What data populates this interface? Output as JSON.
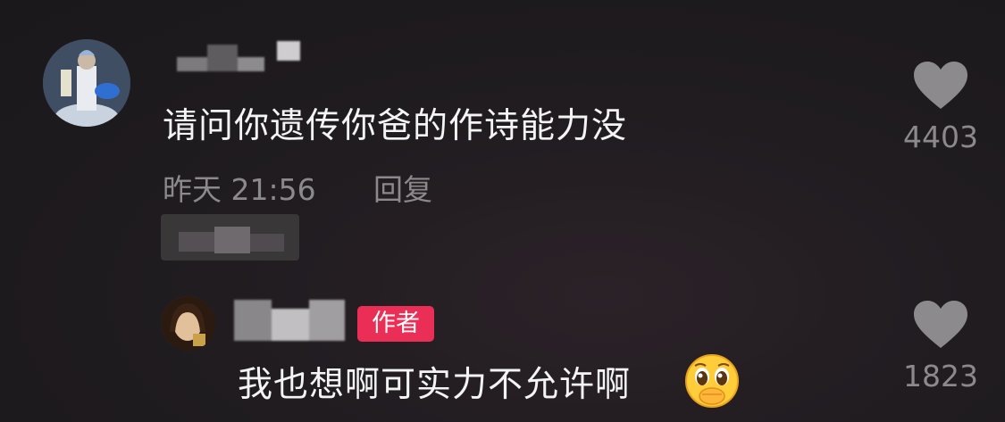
{
  "comments": [
    {
      "text": "请问你遗传你爸的作诗能力没",
      "time": "昨天 21:56",
      "reply_label": "回复",
      "likes": "4403"
    },
    {
      "badge": "作者",
      "text": "我也想啊可实力不允许啊",
      "emoji": "pleading-face-hand-over-mouth",
      "likes": "1823"
    }
  ],
  "colors": {
    "badge": "#ea2e55",
    "meta_text": "#8c898c",
    "body_text": "#f4f4f4",
    "heart": "#8d8a8d"
  }
}
